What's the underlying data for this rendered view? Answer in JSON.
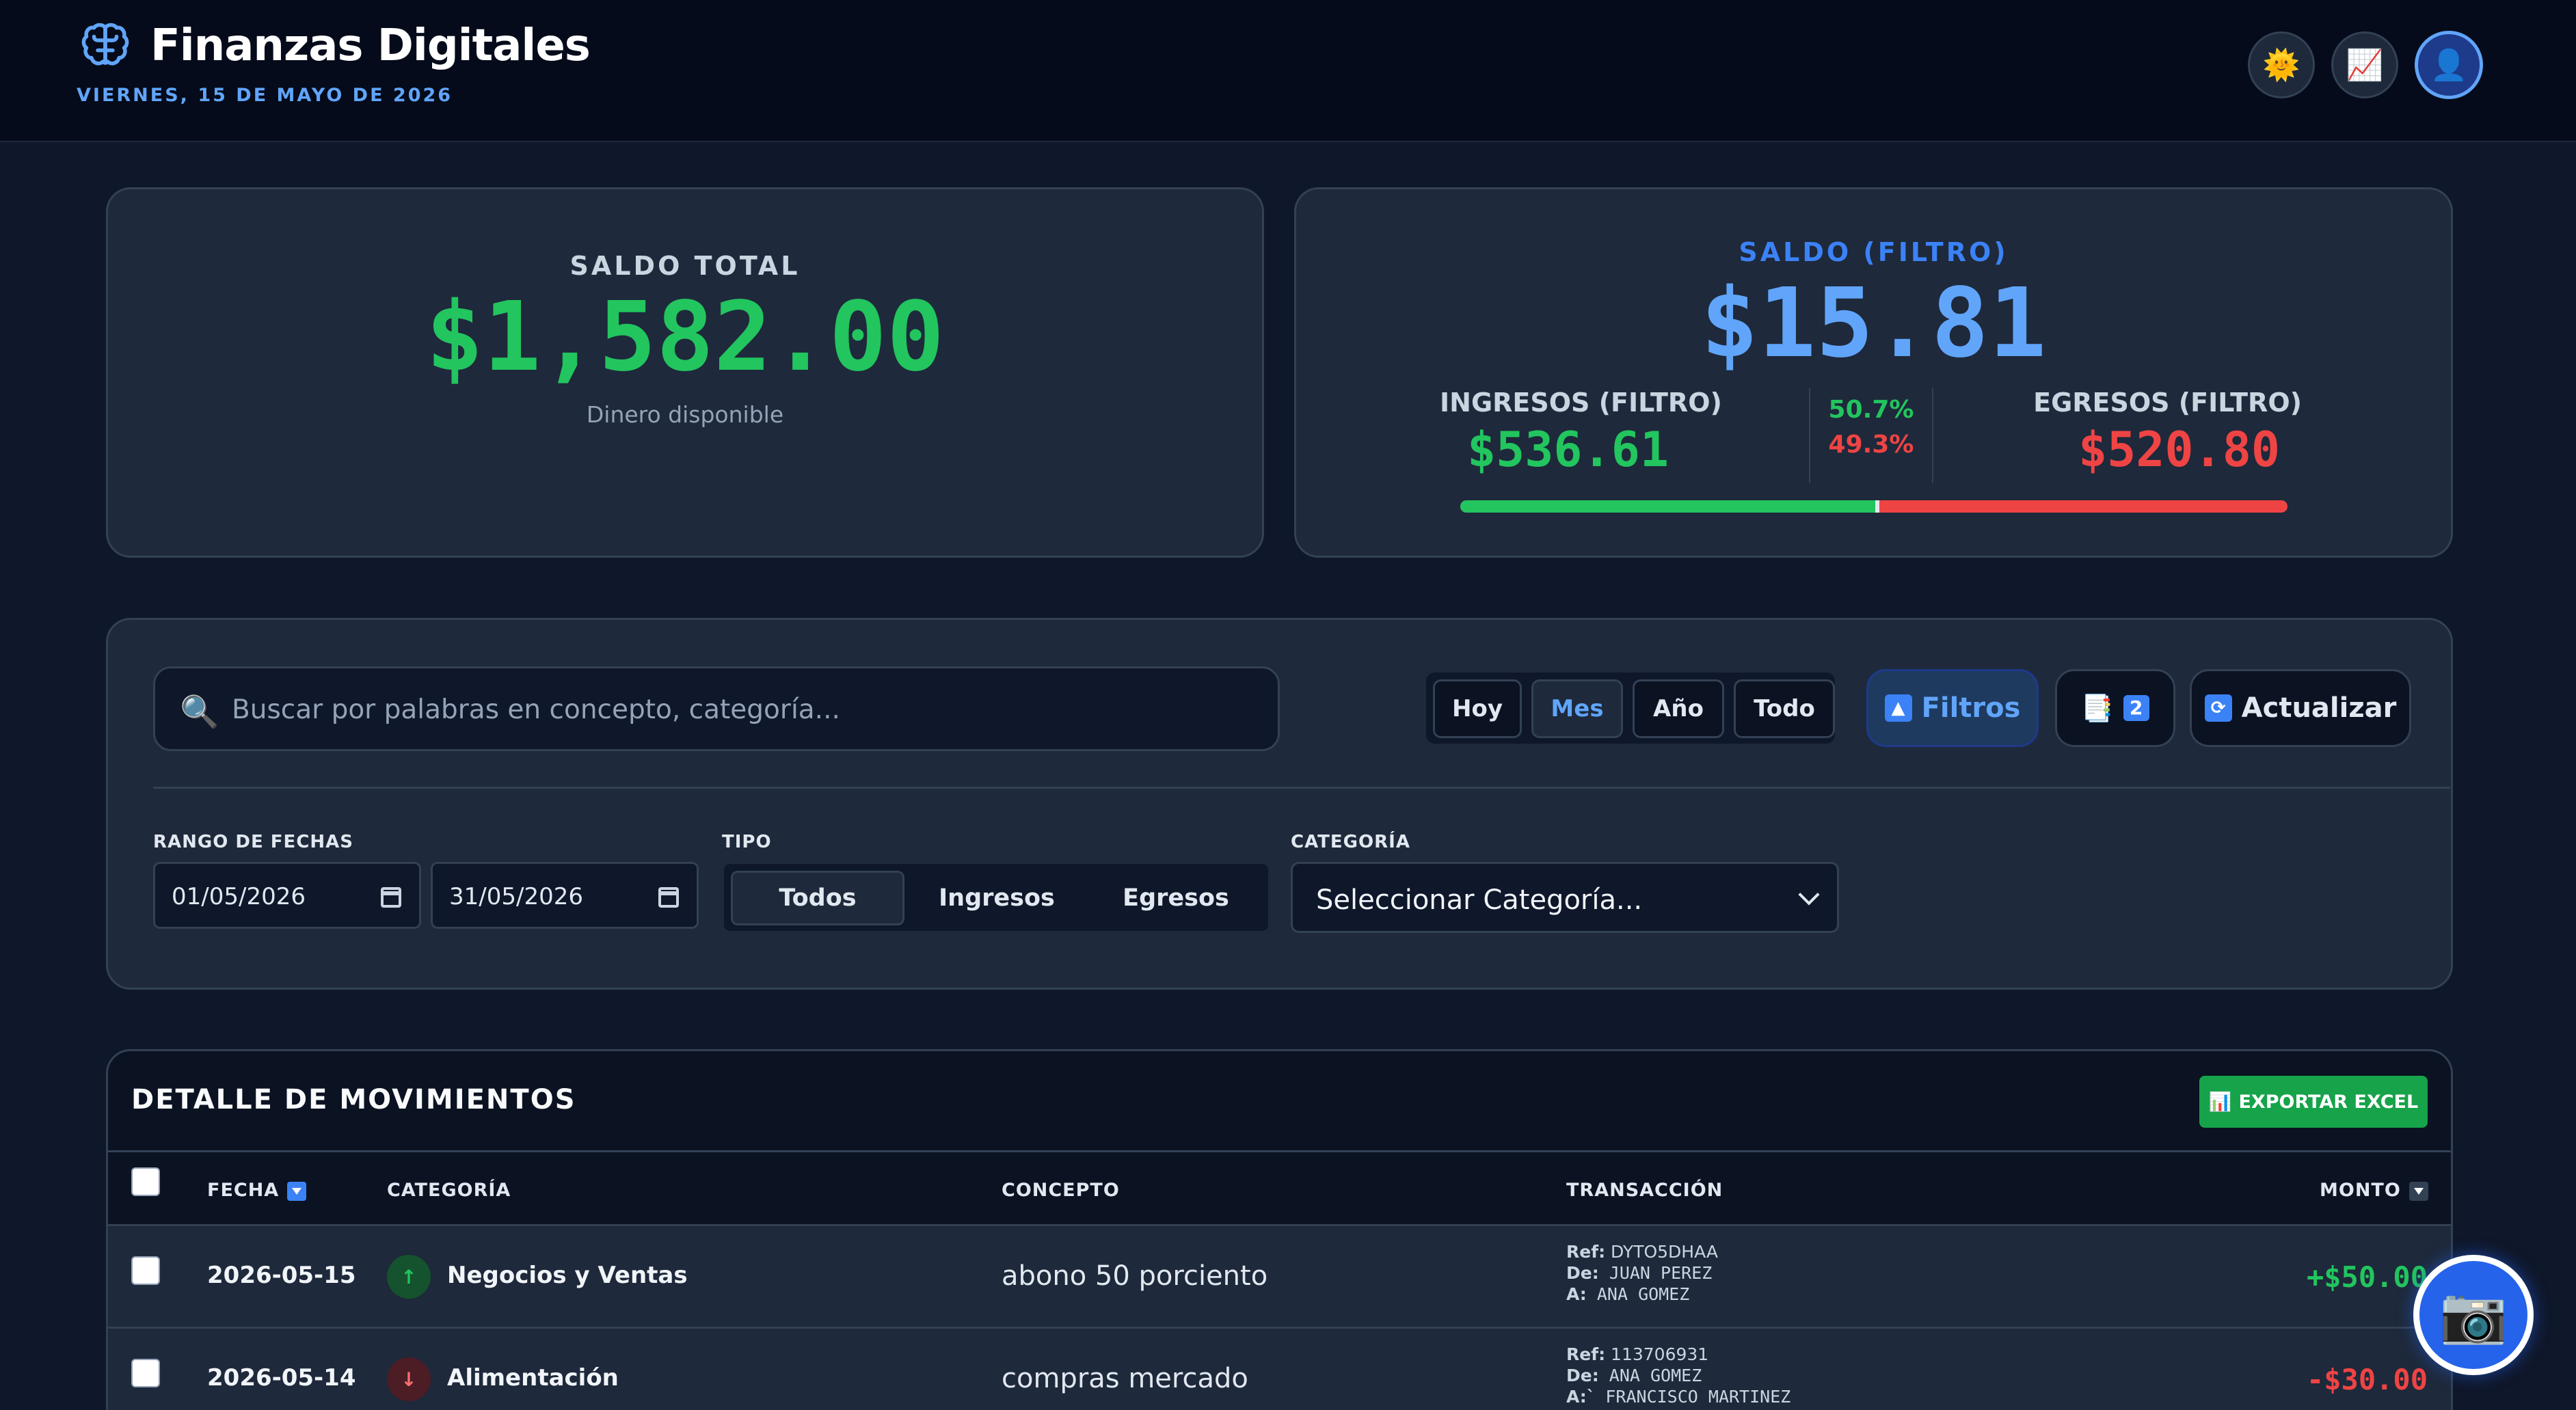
{
  "header": {
    "title": "Finanzas Digitales",
    "date": "VIERNES, 15 DE MAYO DE 2026",
    "actions": [
      {
        "icon": "sun-icon",
        "glyph": "🌞"
      },
      {
        "icon": "chart-icon",
        "glyph": "📈"
      },
      {
        "icon": "user-icon",
        "glyph": "👤"
      }
    ]
  },
  "saldo_total": {
    "label": "SALDO TOTAL",
    "value": "$1,582.00",
    "sub": "Dinero disponible"
  },
  "saldo_filtro": {
    "label": "SALDO (FILTRO)",
    "value": "$15.81",
    "ingresos_label": "INGRESOS (FILTRO)",
    "ingresos_value": "$536.61",
    "egresos_label": "EGRESOS (FILTRO)",
    "egresos_value": "$520.80",
    "ingresos_pct": "50.7%",
    "egresos_pct": "49.3%",
    "ingresos_fraction": 0.507
  },
  "filters": {
    "search_placeholder": "Buscar por palabras en concepto, categoría...",
    "periods": [
      "Hoy",
      "Mes",
      "Año",
      "Todo"
    ],
    "active_period": "Mes",
    "filtros_label": "Filtros",
    "badge_count": "2",
    "refresh_label": "Actualizar",
    "date_range_label": "RANGO DE FECHAS",
    "date_from": "01/05/2026",
    "date_to": "31/05/2026",
    "tipo_label": "TIPO",
    "tipo_options": [
      "Todos",
      "Ingresos",
      "Egresos"
    ],
    "tipo_active": "Todos",
    "categoria_label": "CATEGORÍA",
    "categoria_value": "Seleccionar Categoría..."
  },
  "table": {
    "title": "DETALLE DE MOVIMIENTOS",
    "export_label": "EXPORTAR EXCEL",
    "columns": {
      "fecha": "FECHA",
      "categoria": "CATEGORÍA",
      "concepto": "CONCEPTO",
      "transaccion": "TRANSACCIÓN",
      "monto": "MONTO"
    },
    "rows": [
      {
        "fecha": "2026-05-15",
        "direction": "up",
        "categoria": "Negocios y Ventas",
        "concepto": "abono 50 porciento",
        "ref_label": "Ref:",
        "ref": "DYTO5DHAA",
        "de_label": "De:",
        "de": "JUAN PEREZ",
        "a_label": "A:",
        "a": " ANA GOMEZ",
        "monto": "+$50.00"
      },
      {
        "fecha": "2026-05-14",
        "direction": "down",
        "categoria": "Alimentación",
        "concepto": "compras mercado",
        "ref_label": "Ref:",
        "ref": "113706931",
        "de_label": "De:",
        "de": "ANA GOMEZ",
        "a_label": "A:`",
        "a": "FRANCISCO MARTINEZ",
        "monto": "-$30.00"
      }
    ]
  }
}
